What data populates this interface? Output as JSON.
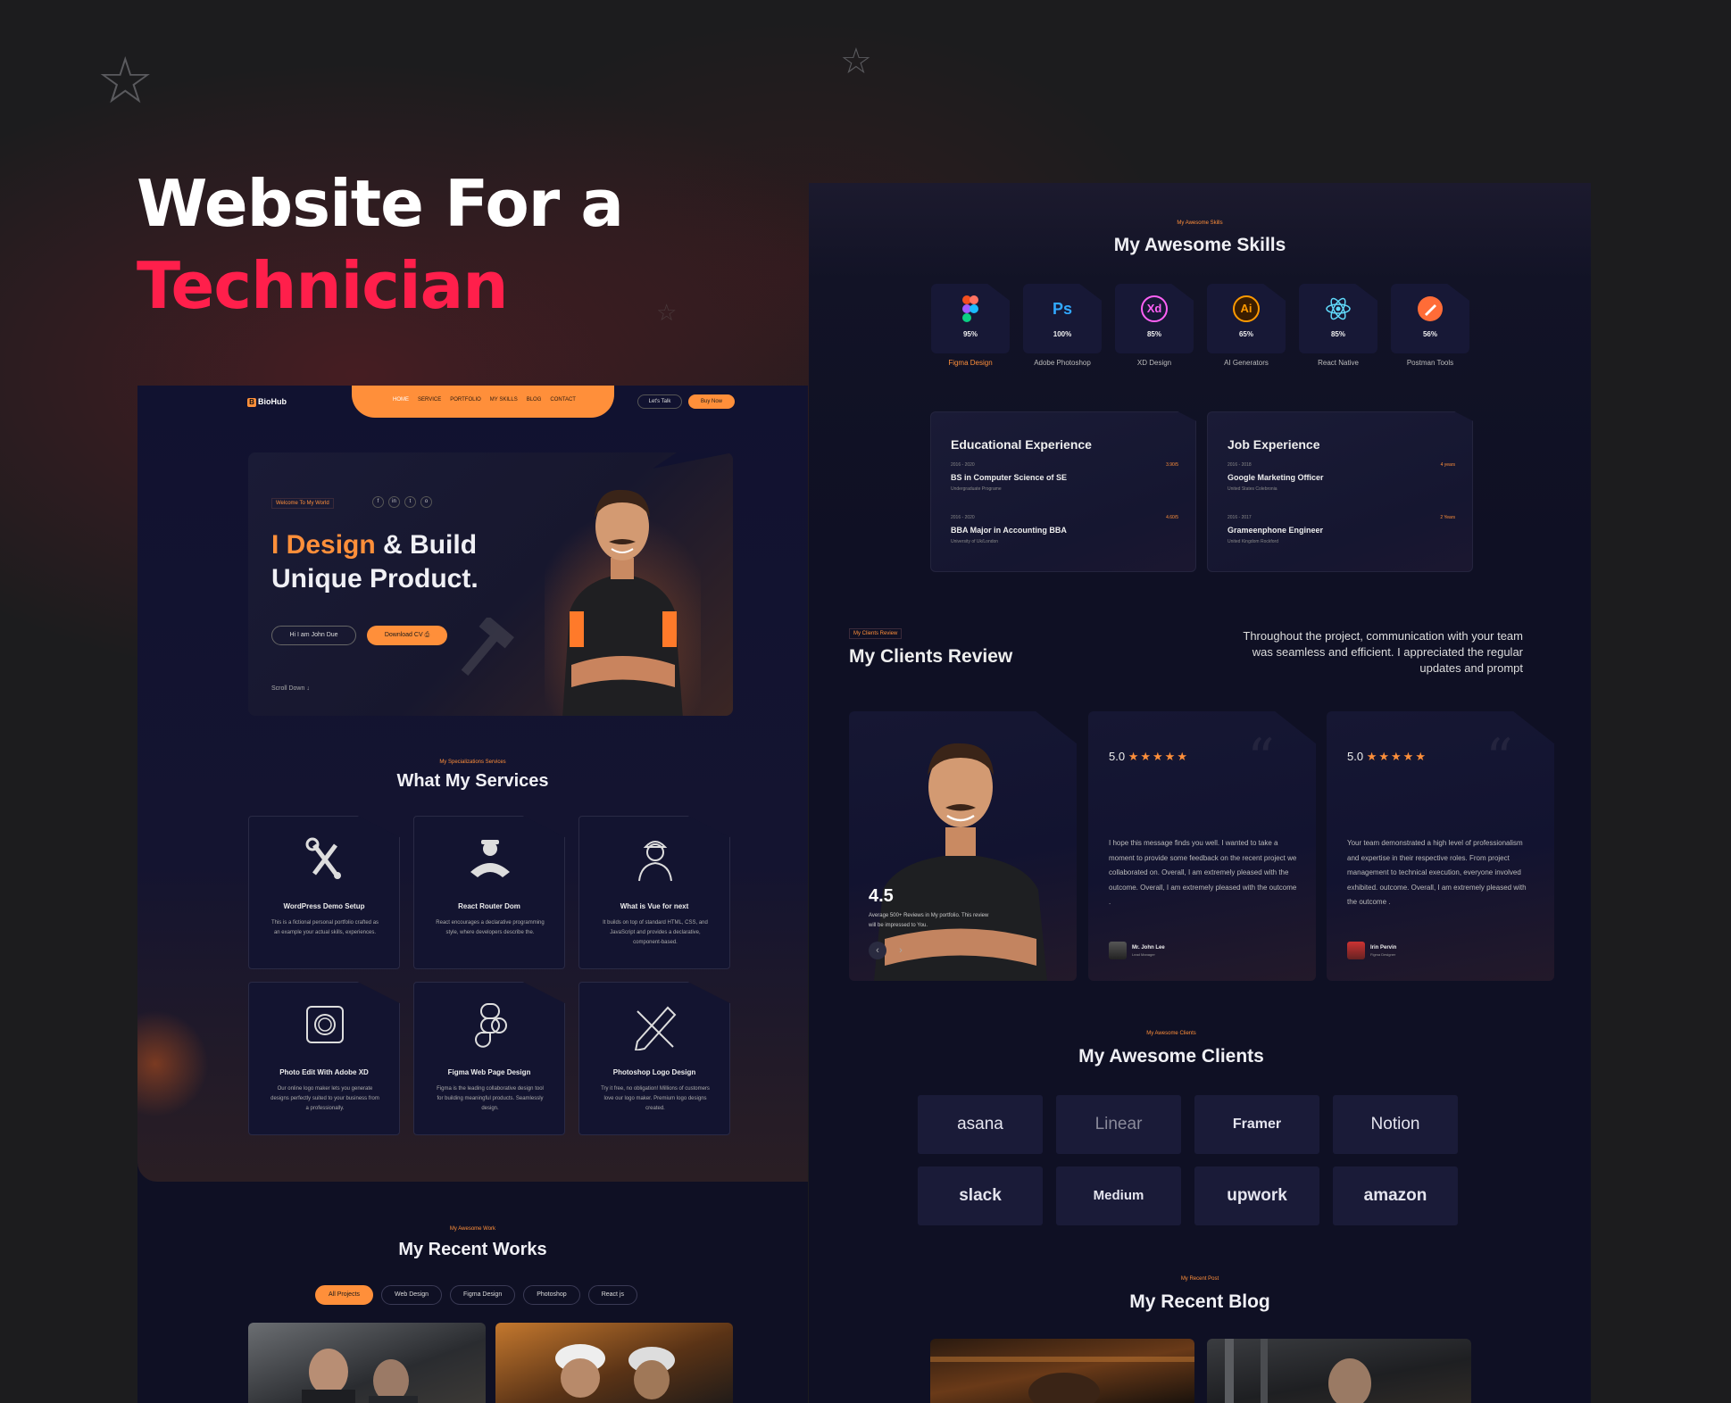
{
  "headline": {
    "line1": "Website For a",
    "line2": "Technician"
  },
  "colors": {
    "accent_orange": "#ff8f3a",
    "headline_pink": "#ff1f4b",
    "panel_bg": "#0f1024"
  },
  "left_panel": {
    "nav": {
      "logo_icon": "B",
      "logo": "BioHub",
      "links": [
        "HOME",
        "SERVICE",
        "PORTFOLIO",
        "MY SKILLS",
        "BLOG",
        "CONTACT"
      ],
      "lets_talk": "Let's Talk",
      "buy_now": "Buy Now"
    },
    "hero": {
      "tag": "Welcome To My World",
      "socials": [
        "f",
        "in",
        "t",
        "o"
      ],
      "title_orange": "I Design",
      "title_rest": " & Build",
      "title_line2": "Unique Product.",
      "btn_name": "Hi I am John Due",
      "btn_cv": "Download CV",
      "cv_icon": "⎙",
      "scroll_label": "Scroll Down",
      "scroll_icon": "↓"
    },
    "services": {
      "tag": "My Specializations Services",
      "title": "What My Services",
      "items": [
        {
          "title": "WordPress Demo Setup",
          "desc": "This is a fictional personal portfolio crafted as an example your actual skills, experiences.",
          "icon": "wrench-screwdriver-icon"
        },
        {
          "title": "React Router Dom",
          "desc": "React encourages a declarative programming style, where developers describe the.",
          "icon": "technician-icon"
        },
        {
          "title": "What is Vue for next",
          "desc": "It builds on top of standard HTML, CSS, and JavaScript and provides a declarative, component-based.",
          "icon": "worker-icon"
        },
        {
          "title": "Photo Edit With  Adobe XD",
          "desc": "Our online logo maker lets you generate designs perfectly suited to your business from a professionally.",
          "icon": "camera-icon"
        },
        {
          "title": "Figma Web Page Design",
          "desc": "Figma is the leading collaborative design tool for building meaningful products. Seamlessly design.",
          "icon": "figma-icon"
        },
        {
          "title": "Photoshop Logo Design",
          "desc": "Try it free, no obligation! Millions of customers love our logo maker. Premium logo designs created.",
          "icon": "pencil-ruler-icon"
        }
      ]
    },
    "works": {
      "tag": "My Awesome Work",
      "title": "My Recent Works",
      "filters": [
        "All Projects",
        "Web Design",
        "Figma Design",
        "Photoshop",
        "React js"
      ]
    }
  },
  "right_panel": {
    "skills": {
      "tag": "My Awesome Skills",
      "title": "My Awesome Skills",
      "items": [
        {
          "label": "Figma Design",
          "pct": "95%",
          "icon": "figma-icon"
        },
        {
          "label": "Adobe Photoshop",
          "pct": "100%",
          "icon": "photoshop-icon",
          "mark": "Ps"
        },
        {
          "label": "XD Design",
          "pct": "85%",
          "icon": "xd-icon",
          "mark": "Xd"
        },
        {
          "label": "AI Generators",
          "pct": "65%",
          "icon": "illustrator-icon",
          "mark": "Ai"
        },
        {
          "label": "React  Native",
          "pct": "85%",
          "icon": "react-icon"
        },
        {
          "label": "Postman Tools",
          "pct": "56%",
          "icon": "postman-icon"
        }
      ]
    },
    "education": {
      "title": "Educational Experience",
      "entries": [
        {
          "years": "2016 - 2020",
          "name": "BS in Computer Science of SE",
          "sub": "Undergraduate Programe",
          "grade": "3.90/5"
        },
        {
          "years": "2016 - 2020",
          "name": "BBA Major in Accounting BBA",
          "sub": "University of Uk/London",
          "grade": "4.60/5"
        }
      ]
    },
    "jobs": {
      "title": "Job Experience",
      "entries": [
        {
          "years": "2016 - 2018",
          "name": "Google Marketing Officer",
          "sub": "United States Colebronia",
          "grade": "4 years"
        },
        {
          "years": "2016 - 2017",
          "name": "Grameenphone Engineer",
          "sub": "United Kingdom Rockford",
          "grade": "2 Years"
        }
      ]
    },
    "reviews": {
      "tag": "My Clients Review",
      "title": "My Clients Review",
      "quote": "Throughout the project, communication with your team was seamless and efficient. I appreciated the regular updates and prompt",
      "rating_big": "4.5",
      "rating_caption": "Average  500+ Reviews in My portfolio. This review will be impressed to You.",
      "prev_icon": "‹",
      "next_icon": "›",
      "stars": "★★★★★",
      "quote_mark": "“",
      "cards": [
        {
          "score": "5.0",
          "text": "I hope this message finds you well. I wanted to take a moment to provide some feedback on the recent project we collaborated on. Overall, I am extremely pleased with the outcome. Overall, I am extremely pleased with the outcome .",
          "name": "Mr. John Lee",
          "role": "Lead Manager"
        },
        {
          "score": "5.0",
          "text": "Your team demonstrated a high level of professionalism and expertise in their respective roles. From project management to technical execution, everyone involved exhibited. outcome. Overall, I am extremely pleased with the outcome .",
          "name": "Irin Pervin",
          "role": "Figma Designer"
        }
      ]
    },
    "clients": {
      "tag": "My Awesome Clients",
      "title": "My Awesome Clients",
      "logos": [
        "asana",
        "Linear",
        "Framer",
        "Notion",
        "slack",
        "Medium",
        "upwork",
        "amazon"
      ]
    },
    "blog": {
      "tag": "My Recent Post",
      "title": "My Recent Blog"
    }
  }
}
